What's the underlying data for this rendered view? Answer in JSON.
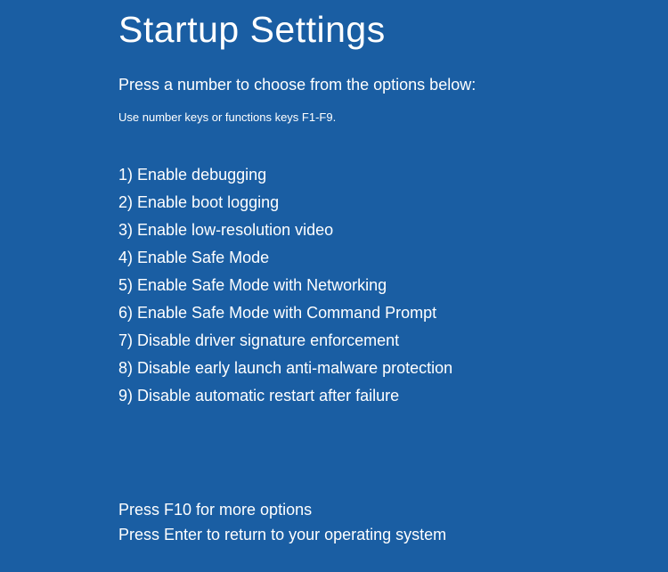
{
  "title": "Startup Settings",
  "subtitle": "Press a number to choose from the options below:",
  "hint": "Use number keys or functions keys F1-F9.",
  "options": [
    "1) Enable debugging",
    "2) Enable boot logging",
    "3) Enable low-resolution video",
    "4) Enable Safe Mode",
    "5) Enable Safe Mode with Networking",
    "6) Enable Safe Mode with Command Prompt",
    "7) Disable driver signature enforcement",
    "8) Disable early launch anti-malware protection",
    "9) Disable automatic restart after failure"
  ],
  "footer": {
    "more_options": "Press F10 for more options",
    "return": "Press Enter to return to your operating system"
  }
}
